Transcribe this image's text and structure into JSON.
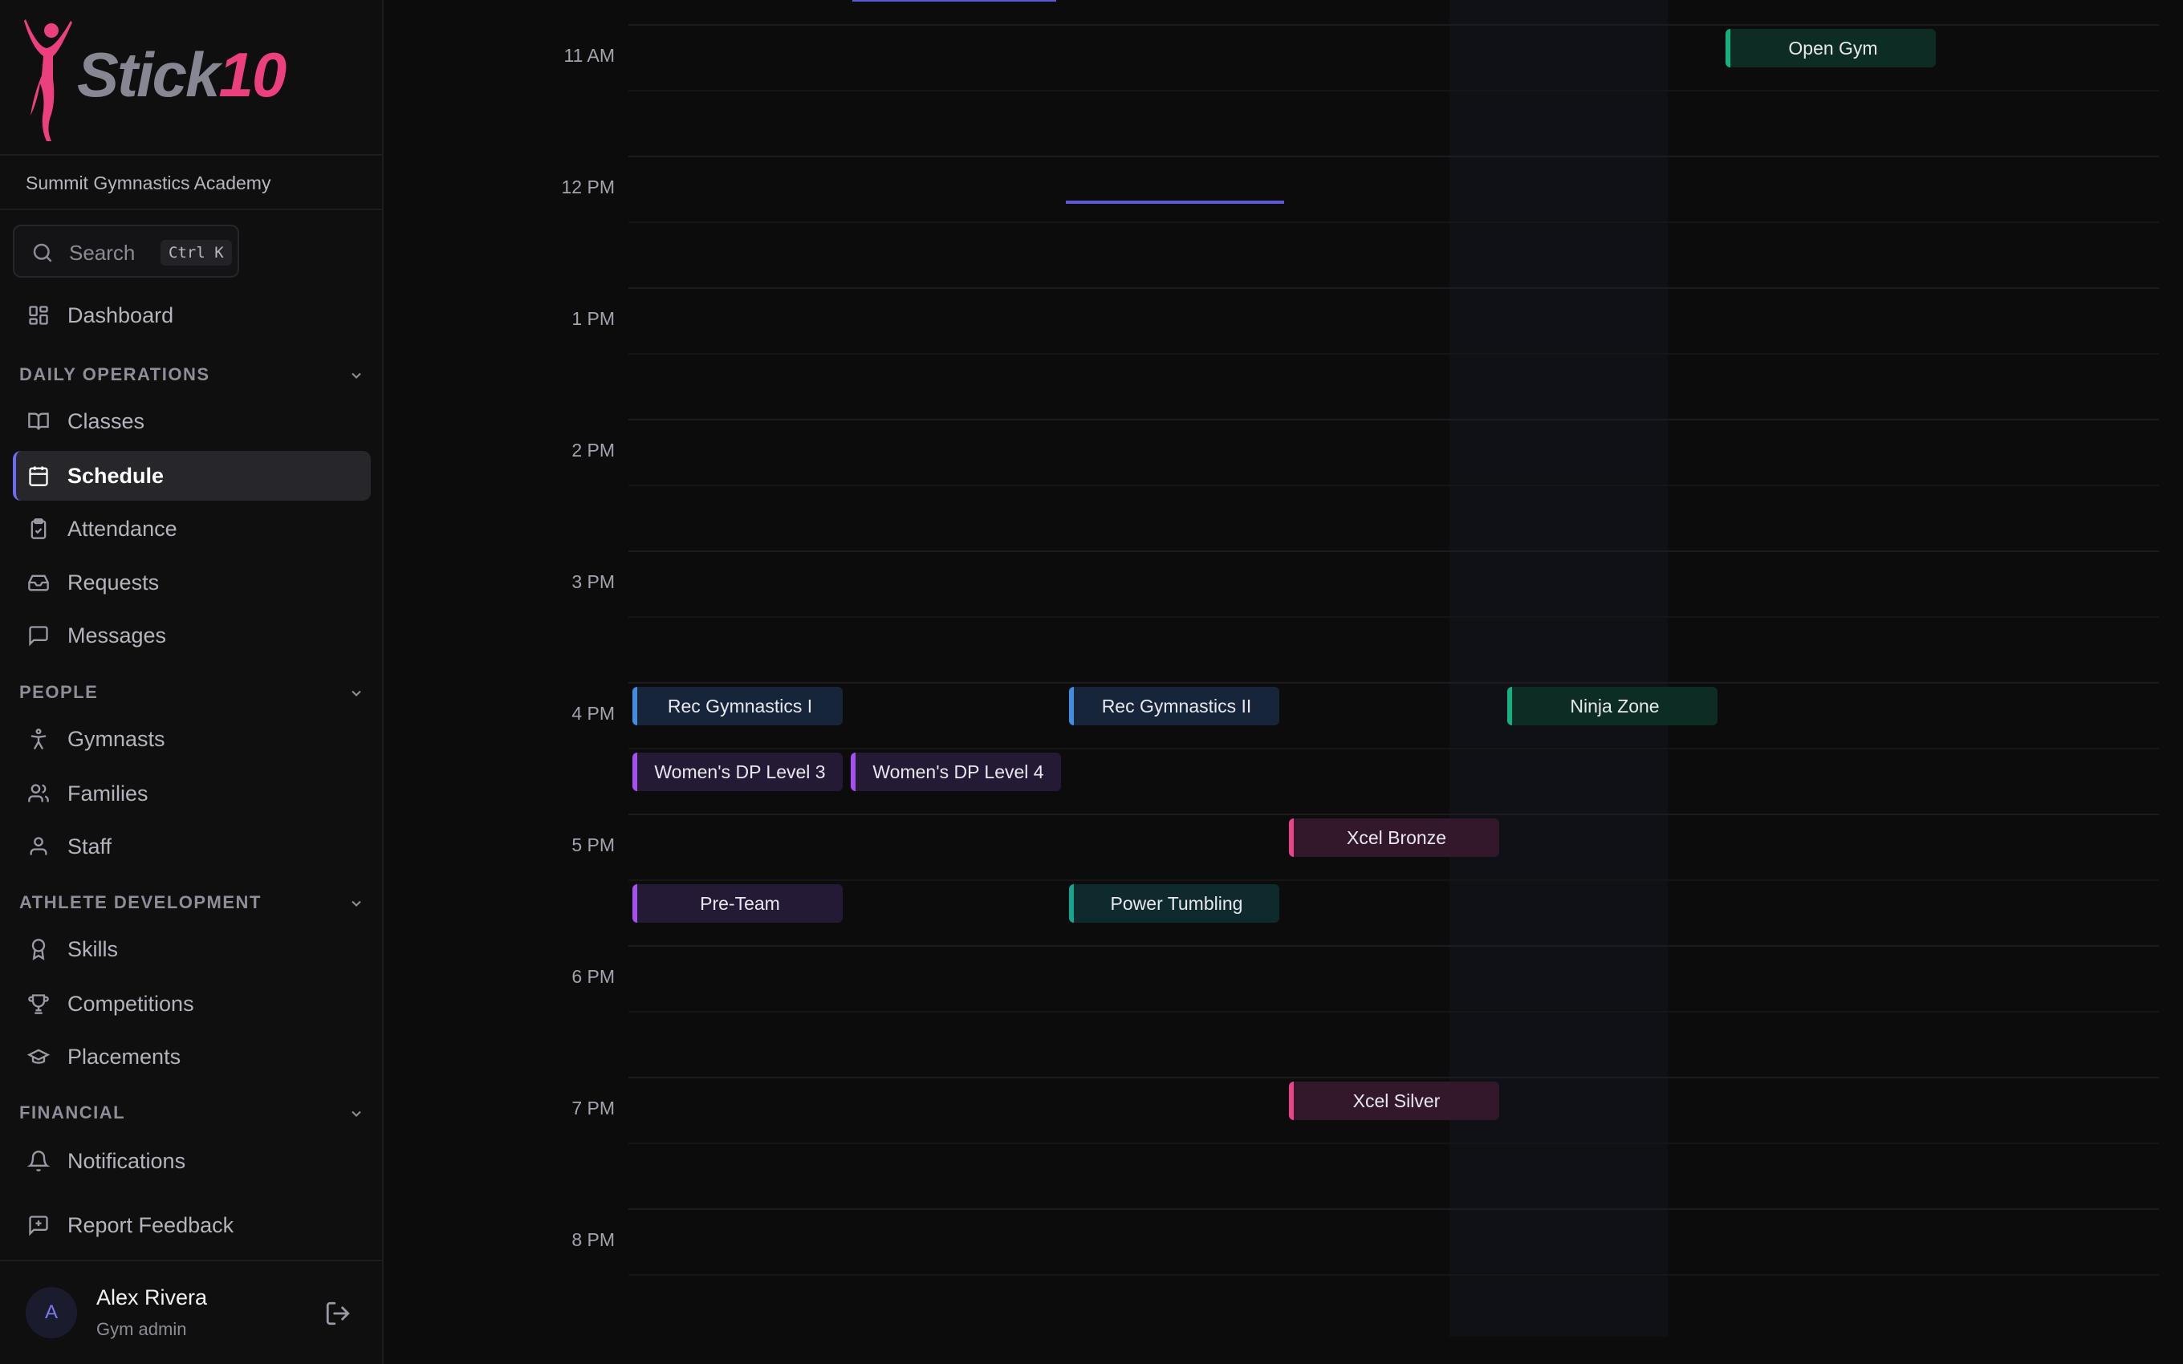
{
  "brand": {
    "name_part1": "Stick",
    "name_part2": "10",
    "accent": "#ec3f7e",
    "organization": "Summit Gymnastics Academy"
  },
  "search": {
    "label": "Search",
    "shortcut": "Ctrl K"
  },
  "nav": {
    "dashboard": "Dashboard",
    "sections": [
      {
        "title": "DAILY OPERATIONS",
        "items": [
          {
            "label": "Classes",
            "icon": "book-open-icon"
          },
          {
            "label": "Schedule",
            "icon": "calendar-icon",
            "active": true
          },
          {
            "label": "Attendance",
            "icon": "clipboard-check-icon"
          },
          {
            "label": "Requests",
            "icon": "inbox-icon"
          },
          {
            "label": "Messages",
            "icon": "message-square-icon"
          }
        ]
      },
      {
        "title": "PEOPLE",
        "items": [
          {
            "label": "Gymnasts",
            "icon": "person-stretch-icon"
          },
          {
            "label": "Families",
            "icon": "users-icon"
          },
          {
            "label": "Staff",
            "icon": "user-icon"
          }
        ]
      },
      {
        "title": "ATHLETE DEVELOPMENT",
        "items": [
          {
            "label": "Skills",
            "icon": "award-icon"
          },
          {
            "label": "Competitions",
            "icon": "trophy-icon"
          },
          {
            "label": "Placements",
            "icon": "graduation-cap-icon"
          }
        ]
      },
      {
        "title": "FINANCIAL",
        "items": [
          {
            "label": "Notifications",
            "icon": "bell-icon"
          }
        ]
      }
    ],
    "feedback": "Report Feedback"
  },
  "user": {
    "initial": "A",
    "name": "Alex Rivera",
    "role": "Gym admin"
  },
  "calendar": {
    "time_labels": [
      "11 AM",
      "12 PM",
      "1 PM",
      "2 PM",
      "3 PM",
      "4 PM",
      "5 PM",
      "6 PM",
      "7 PM",
      "8 PM"
    ],
    "events": [
      {
        "title": "Open Gym",
        "color": "green"
      },
      {
        "title": "Rec Gymnastics I",
        "color": "blue"
      },
      {
        "title": "Rec Gymnastics II",
        "color": "blue"
      },
      {
        "title": "Ninja Zone",
        "color": "green"
      },
      {
        "title": "Women's DP Level 3",
        "color": "purple"
      },
      {
        "title": "Women's DP Level 4",
        "color": "purple"
      },
      {
        "title": "Xcel Bronze",
        "color": "pink"
      },
      {
        "title": "Pre-Team",
        "color": "purple"
      },
      {
        "title": "Power Tumbling",
        "color": "teal"
      },
      {
        "title": "Xcel Silver",
        "color": "pink"
      }
    ],
    "colors": {
      "blue": "#3f8fde",
      "purple": "#a551f0",
      "green": "#16b07e",
      "teal": "#17a48c",
      "pink": "#e7458a",
      "now_indicator": "#5a5ad6"
    }
  }
}
